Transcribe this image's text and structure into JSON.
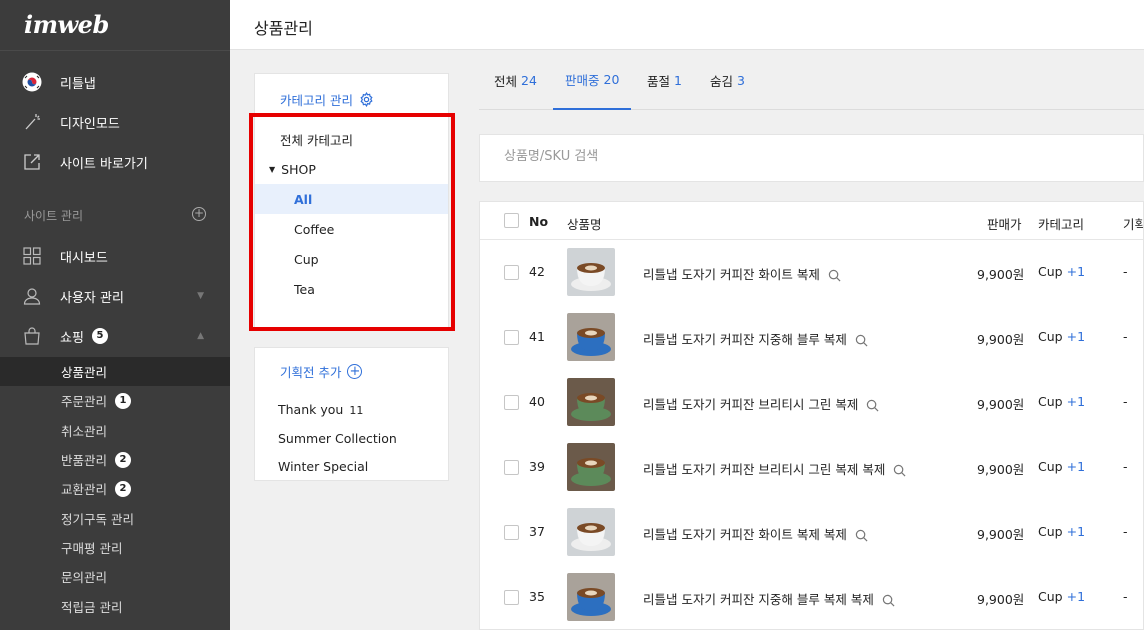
{
  "sidebar": {
    "logo": "imweb",
    "main_items": [
      {
        "label": "리틀냅",
        "icon": "korea-flag-icon"
      },
      {
        "label": "디자인모드",
        "icon": "magic-wand-icon"
      },
      {
        "label": "사이트 바로가기",
        "icon": "external-link-icon"
      }
    ],
    "section_title": "사이트 관리",
    "sub_items": [
      {
        "label": "대시보드",
        "icon": "grid-icon"
      },
      {
        "label": "사용자 관리",
        "icon": "user-icon"
      },
      {
        "label": "쇼핑",
        "icon": "shopping-bag-icon",
        "badge": "5"
      }
    ],
    "shop_items": [
      {
        "label": "상품관리",
        "badge": ""
      },
      {
        "label": "주문관리",
        "badge": "1"
      },
      {
        "label": "취소관리",
        "badge": ""
      },
      {
        "label": "반품관리",
        "badge": "2"
      },
      {
        "label": "교환관리",
        "badge": "2"
      },
      {
        "label": "정기구독 관리",
        "badge": ""
      },
      {
        "label": "구매평 관리",
        "badge": ""
      },
      {
        "label": "문의관리",
        "badge": ""
      },
      {
        "label": "적립금 관리",
        "badge": ""
      }
    ]
  },
  "header": {
    "title": "상품관리"
  },
  "categories": {
    "manage_label": "카테고리 관리",
    "all_label": "전체 카테고리",
    "group_label": "SHOP",
    "items": [
      "All",
      "Coffee",
      "Cup",
      "Tea"
    ],
    "selected": "All"
  },
  "exhibitions": {
    "add_label": "기획전 추가",
    "items": [
      {
        "name": "Thank you",
        "count": "11"
      },
      {
        "name": "Summer Collection",
        "count": ""
      },
      {
        "name": "Winter Special",
        "count": ""
      }
    ]
  },
  "tabs": [
    {
      "label": "전체",
      "count": "24"
    },
    {
      "label": "판매중",
      "count": "20"
    },
    {
      "label": "품절",
      "count": "1"
    },
    {
      "label": "숨김",
      "count": "3"
    }
  ],
  "search": {
    "placeholder": "상품명/SKU 검색"
  },
  "table": {
    "headers": {
      "no": "No",
      "name": "상품명",
      "price": "판매가",
      "category": "카테고리",
      "extra": "기획"
    },
    "rows": [
      {
        "no": "42",
        "name": "리틀냅 도자기 커피잔 화이트 복제",
        "price": "9,900원",
        "category": "Cup",
        "more": "+1",
        "extra": "-",
        "thumb": "white"
      },
      {
        "no": "41",
        "name": "리틀냅 도자기 커피잔 지중해 블루 복제",
        "price": "9,900원",
        "category": "Cup",
        "more": "+1",
        "extra": "-",
        "thumb": "blue"
      },
      {
        "no": "40",
        "name": "리틀냅 도자기 커피잔 브리티시 그린 복제",
        "price": "9,900원",
        "category": "Cup",
        "more": "+1",
        "extra": "-",
        "thumb": "green"
      },
      {
        "no": "39",
        "name": "리틀냅 도자기 커피잔 브리티시 그린 복제 복제",
        "price": "9,900원",
        "category": "Cup",
        "more": "+1",
        "extra": "-",
        "thumb": "green"
      },
      {
        "no": "37",
        "name": "리틀냅 도자기 커피잔 화이트 복제 복제",
        "price": "9,900원",
        "category": "Cup",
        "more": "+1",
        "extra": "-",
        "thumb": "white"
      },
      {
        "no": "35",
        "name": "리틀냅 도자기 커피잔 지중해 블루 복제 복제",
        "price": "9,900원",
        "category": "Cup",
        "more": "+1",
        "extra": "-",
        "thumb": "blue"
      }
    ]
  },
  "colors": {
    "accent": "#2f6fd9",
    "sidebar_bg": "#3c3c3c",
    "highlight": "#e60000"
  }
}
